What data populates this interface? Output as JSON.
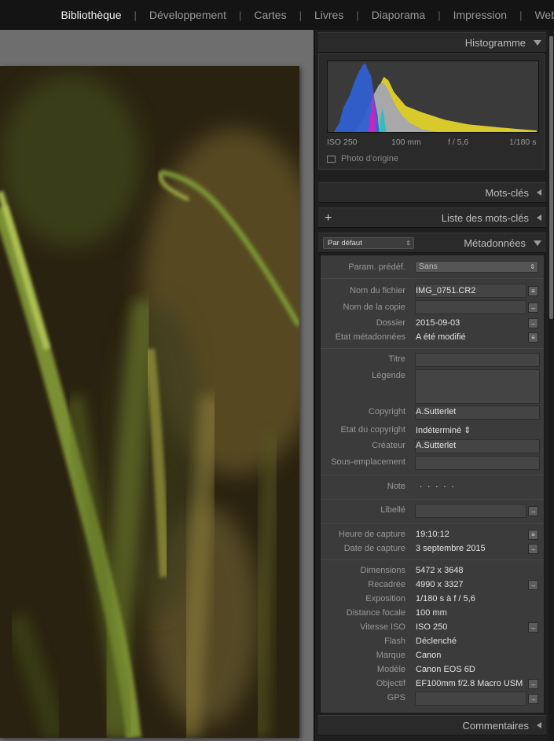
{
  "nav": {
    "items": [
      "Bibliothèque",
      "Développement",
      "Cartes",
      "Livres",
      "Diaporama",
      "Impression",
      "Web"
    ],
    "active": "Bibliothèque"
  },
  "panels": {
    "histogram": {
      "title": "Histogramme",
      "iso": "ISO 250",
      "focal": "100 mm",
      "aperture": "f / 5,6",
      "shutter": "1/180 s",
      "original_photo_label": "Photo d'origine"
    },
    "keywords": {
      "title": "Mots-clés"
    },
    "keyword_list": {
      "title": "Liste des mots-clés"
    },
    "metadata": {
      "title": "Métadonnées",
      "preset_select": "Par défaut",
      "preset_label": "Param. prédéf.",
      "preset_value": "Sans",
      "fields": {
        "filename_label": "Nom du fichier",
        "filename": "IMG_0751.CR2",
        "copy_name_label": "Nom de la copie",
        "folder_label": "Dossier",
        "folder": "2015-09-03",
        "meta_status_label": "Etat métadonnées",
        "meta_status": "A été modifié",
        "title_label": "Titre",
        "caption_label": "Légende",
        "copyright_label": "Copyright",
        "copyright": "A.Sutterlet",
        "copyright_status_label": "Etat du copyright",
        "copyright_status": "Indéterminé",
        "creator_label": "Créateur",
        "creator": "A.Sutterlet",
        "sublocation_label": "Sous-emplacement",
        "rating_label": "Note",
        "rating_dots": ". . . . .",
        "label_label": "Libellé",
        "capture_time_label": "Heure de capture",
        "capture_time": "19:10:12",
        "capture_date_label": "Date de capture",
        "capture_date": "3 septembre 2015",
        "dimensions_label": "Dimensions",
        "dimensions": "5472 x 3648",
        "cropped_label": "Recadrée",
        "cropped": "4990 x 3327",
        "exposure_label": "Exposition",
        "exposure": "1/180 s à f / 5,6",
        "focal_label": "Distance focale",
        "focal": "100 mm",
        "iso_label": "Vitesse ISO",
        "iso": "ISO 250",
        "flash_label": "Flash",
        "flash": "Déclenché",
        "make_label": "Marque",
        "make": "Canon",
        "model_label": "Modèle",
        "model": "Canon EOS 6D",
        "lens_label": "Objectif",
        "lens": "EF100mm f/2.8 Macro USM",
        "gps_label": "GPS"
      }
    },
    "comments": {
      "title": "Commentaires"
    }
  },
  "histogram_colors": {
    "blue": "#2f5fd0",
    "yellow": "#e2d22a",
    "gray": "#a8a8a8",
    "magenta": "#d020c0",
    "cyan": "#20c0c0"
  }
}
